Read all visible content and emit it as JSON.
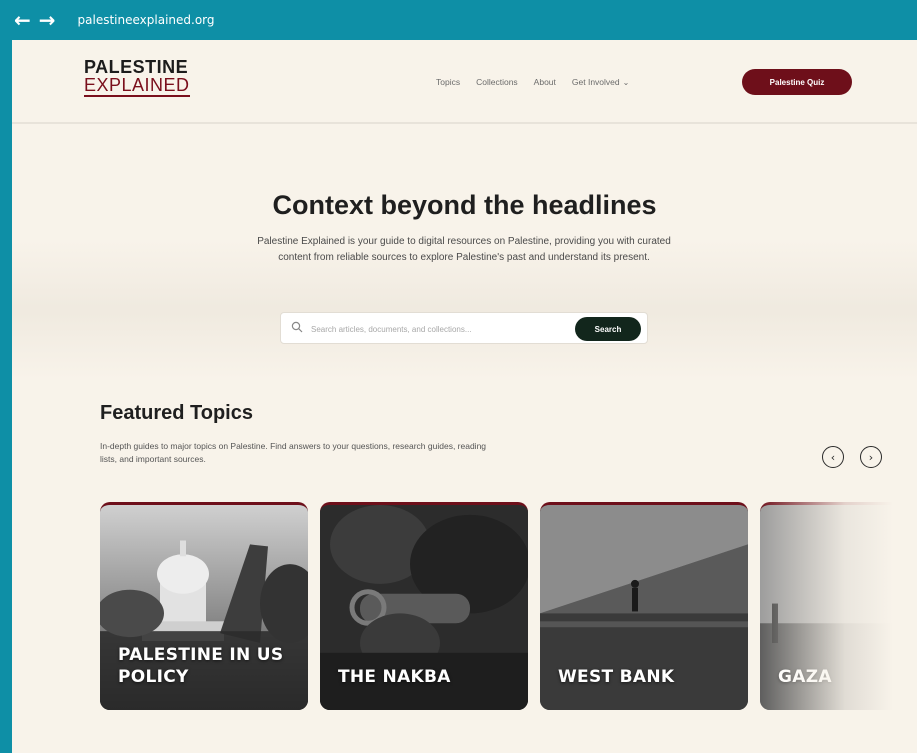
{
  "browser": {
    "url": "palestineexplained.org",
    "back_icon": "arrow-left-icon",
    "forward_icon": "arrow-right-icon"
  },
  "header": {
    "logo_top": "PALESTINE",
    "logo_bottom": "EXPLAINED",
    "nav": [
      "Topics",
      "Collections",
      "About",
      "Get Involved"
    ],
    "cta": "Palestine Quiz"
  },
  "hero": {
    "title": "Context beyond the headlines",
    "description": "Palestine Explained is your guide to digital resources on Palestine, providing you with curated content from reliable sources to explore Palestine's past and understand its present.",
    "search_placeholder": "Search articles, documents, and collections...",
    "search_button": "Search"
  },
  "featured": {
    "title": "Featured Topics",
    "description": "In-depth guides to major topics on Palestine. Find answers to your questions, research guides, reading lists, and important sources.",
    "cards": [
      {
        "label": "PALESTINE IN US POLICY"
      },
      {
        "label": "THE NAKBA"
      },
      {
        "label": "WEST BANK"
      },
      {
        "label": "GAZA"
      }
    ]
  },
  "colors": {
    "browser_bar": "#0e8fa6",
    "page_bg": "#f8f3ea",
    "brand_red": "#6e0f1a",
    "search_button": "#12261c"
  }
}
